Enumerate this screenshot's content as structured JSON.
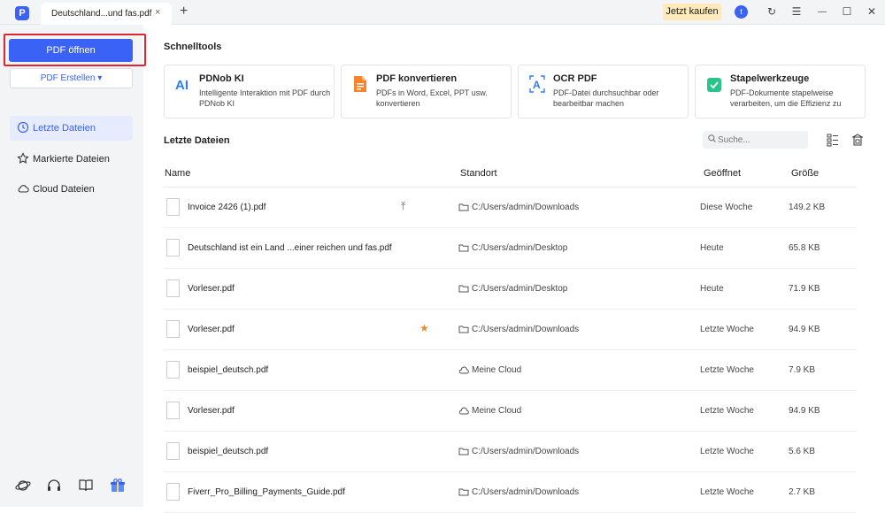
{
  "titlebar": {
    "logo_glyph": "P",
    "tab_title": "Deutschland...und fas.pdf",
    "tab_close": "×",
    "new_tab": "+",
    "buy_label": "Jetzt kaufen",
    "avatar_letter": "t",
    "refresh_glyph": "↻",
    "menu_glyph": "☰",
    "minimize_glyph": "—",
    "maximize_glyph": "☐",
    "close_glyph": "✕"
  },
  "sidebar": {
    "open_label": "PDF öffnen",
    "create_label": "PDF Erstellen ▾",
    "items": [
      {
        "label": "Letzte Dateien",
        "icon": "clock-icon"
      },
      {
        "label": "Markierte Dateien",
        "icon": "star-icon"
      },
      {
        "label": "Cloud Dateien",
        "icon": "cloud-icon"
      }
    ]
  },
  "quicktools": {
    "title": "Schnelltools",
    "cards": [
      {
        "title": "PDNob KI",
        "desc": "Intelligente Interaktion mit PDF durch PDNob KI",
        "icon": "ai-icon"
      },
      {
        "title": "PDF konvertieren",
        "desc": "PDFs in Word, Excel, PPT usw. konvertieren",
        "icon": "convert-icon"
      },
      {
        "title": "OCR PDF",
        "desc": "PDF-Datei durchsuchbar oder bearbeitbar machen",
        "icon": "ocr-icon"
      },
      {
        "title": "Stapelwerkzeuge",
        "desc": "PDF-Dokumente stapelweise verarbeiten, um die Effizienz zu",
        "icon": "batch-icon"
      }
    ]
  },
  "recent": {
    "title": "Letzte Dateien",
    "search_placeholder": "Suche...",
    "columns": {
      "name": "Name",
      "location": "Standort",
      "opened": "Geöffnet",
      "size": "Größe"
    },
    "rows": [
      {
        "name": "Invoice 2426 (1).pdf",
        "location": "C:/Users/admin/Downloads",
        "loc_type": "folder",
        "opened": "Diese Woche",
        "size": "149.2 KB",
        "pin": true,
        "star": false
      },
      {
        "name": "Deutschland ist ein Land ...einer reichen und fas.pdf",
        "location": "C:/Users/admin/Desktop",
        "loc_type": "folder",
        "opened": "Heute",
        "size": "65.8 KB",
        "pin": false,
        "star": false
      },
      {
        "name": "Vorleser.pdf",
        "location": "C:/Users/admin/Desktop",
        "loc_type": "folder",
        "opened": "Heute",
        "size": "71.9 KB",
        "pin": false,
        "star": false
      },
      {
        "name": "Vorleser.pdf",
        "location": "C:/Users/admin/Downloads",
        "loc_type": "folder",
        "opened": "Letzte Woche",
        "size": "94.9 KB",
        "pin": false,
        "star": true
      },
      {
        "name": "beispiel_deutsch.pdf",
        "location": "Meine Cloud",
        "loc_type": "cloud",
        "opened": "Letzte Woche",
        "size": "7.9 KB",
        "pin": false,
        "star": false
      },
      {
        "name": "Vorleser.pdf",
        "location": "Meine Cloud",
        "loc_type": "cloud",
        "opened": "Letzte Woche",
        "size": "94.9 KB",
        "pin": false,
        "star": false
      },
      {
        "name": "beispiel_deutsch.pdf",
        "location": "C:/Users/admin/Downloads",
        "loc_type": "folder",
        "opened": "Letzte Woche",
        "size": "5.6 KB",
        "pin": false,
        "star": false
      },
      {
        "name": "Fiverr_Pro_Billing_Payments_Guide.pdf",
        "location": "C:/Users/admin/Downloads",
        "loc_type": "folder",
        "opened": "Letzte Woche",
        "size": "2.7 KB",
        "pin": false,
        "star": false
      }
    ],
    "pin_glyph": "⤒",
    "star_glyph": "★"
  },
  "colors": {
    "accent": "#3a63f5",
    "sidebar_bg": "#f3f4f6",
    "highlight": "#e3262e",
    "buy_bg": "#fde9b9",
    "star": "#f08a24"
  }
}
